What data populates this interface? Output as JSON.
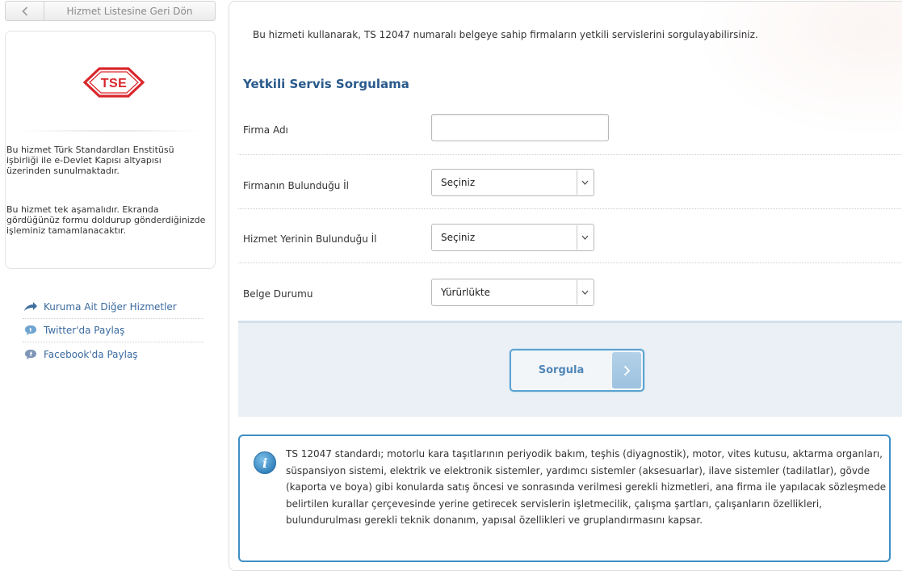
{
  "sidebar": {
    "back_label": "Hizmet Listesine Geri Dön",
    "logo_text": "TSE",
    "info_p1": "Bu hizmet Türk Standardları Enstitüsü işbirliği ile e-Devlet Kapısı altyapısı üzerinden sunulmaktadır.",
    "info_p2": "Bu hizmet tek aşamalıdır. Ekranda gördüğünüz formu doldurup gönderdiğinizde işleminiz tamamlanacaktır.",
    "links": [
      {
        "label": "Kuruma Ait Diğer Hizmetler",
        "icon": "share-arrow-icon"
      },
      {
        "label": "Twitter'da Paylaş",
        "icon": "twitter-icon"
      },
      {
        "label": "Facebook'da Paylaş",
        "icon": "facebook-icon"
      }
    ]
  },
  "main": {
    "intro": "Bu hizmeti kullanarak, TS 12047 numaralı belgeye sahip firmaların yetkili servislerini sorgulayabilirsiniz.",
    "title": "Yetkili Servis Sorgulama",
    "form": {
      "firma_adi": {
        "label": "Firma Adı",
        "value": ""
      },
      "firma_il": {
        "label": "Firmanın Bulunduğu İl",
        "selected": "Seçiniz"
      },
      "hizmet_il": {
        "label": "Hizmet Yerinin Bulunduğu İl",
        "selected": "Seçiniz"
      },
      "belge_durumu": {
        "label": "Belge Durumu",
        "selected": "Yürürlükte"
      }
    },
    "submit_label": "Sorgula",
    "note": "TS 12047 standardı; motorlu kara taşıtlarının periyodik bakım, teşhis (diyagnostik), motor, vites kutusu, aktarma organları, süspansiyon sistemi, elektrik ve elektronik sistemler, yardımcı sistemler (aksesuarlar), ilave sistemler (tadilatlar), gövde (kaporta ve boya) gibi konularda satış öncesi ve sonrasında verilmesi gerekli hizmetleri, ana firma ile yapılacak sözleşmede belirtilen kurallar çerçevesinde yerine getirecek servislerin işletmecilik, çalışma şartları, çalışanların özellikleri, bulundurulması gerekli teknik donanım, yapısal özellikleri ve gruplandırmasını kapsar."
  },
  "colors": {
    "accent_blue": "#2a5a8c",
    "link_blue": "#3a6aa0",
    "tse_red": "#d9262b",
    "note_border": "#3d8fc6"
  }
}
